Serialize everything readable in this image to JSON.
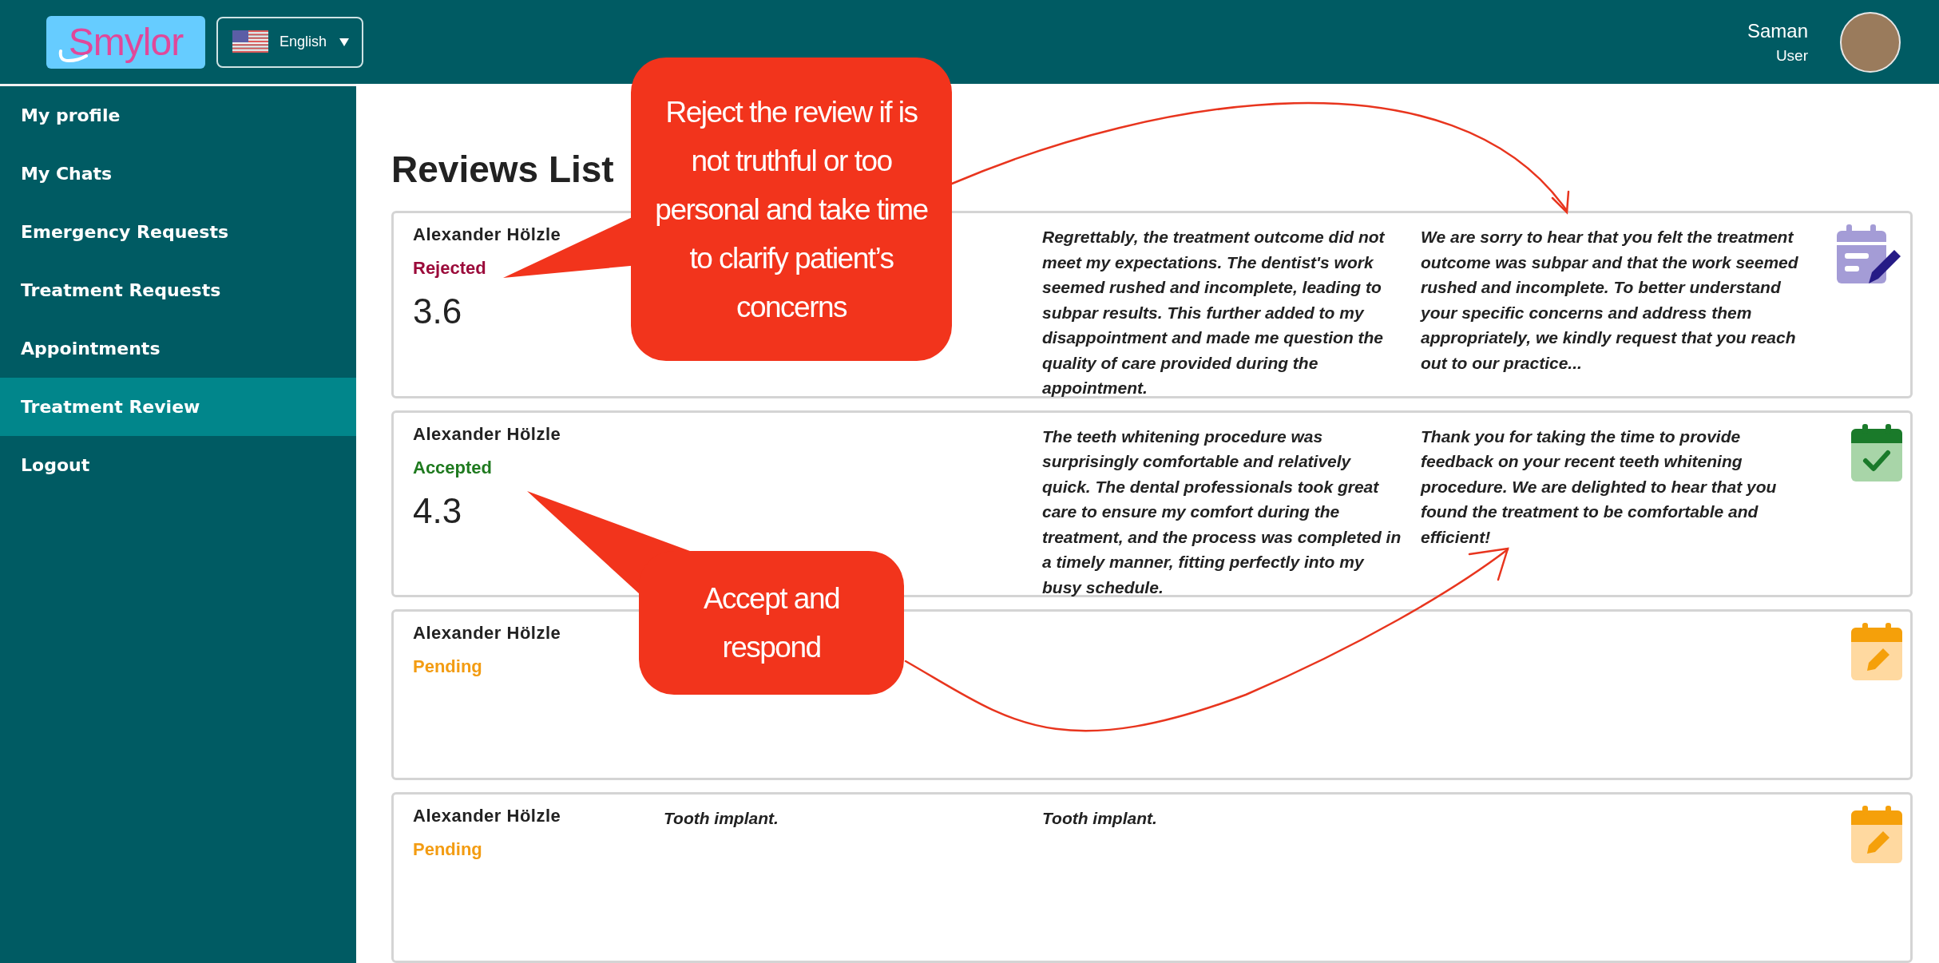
{
  "header": {
    "logo": "Smylor",
    "language": {
      "label": "English"
    },
    "user": {
      "name": "Saman",
      "role": "User"
    }
  },
  "sidebar": {
    "items": [
      {
        "label": "My profile",
        "selected": false
      },
      {
        "label": "My Chats",
        "selected": false
      },
      {
        "label": "Emergency Requests",
        "selected": false
      },
      {
        "label": "Treatment Requests",
        "selected": false
      },
      {
        "label": "Appointments",
        "selected": false
      },
      {
        "label": "Treatment Review",
        "selected": true
      },
      {
        "label": "Logout",
        "selected": false
      }
    ]
  },
  "page_title": "Reviews List",
  "reviews": [
    {
      "name": "Alexander Hölzle",
      "status": {
        "label": "Rejected",
        "kind": "rejected"
      },
      "rating": "3.6",
      "review": "Regrettably, the treatment outcome did not meet my expectations. The dentist's work seemed rushed and incomplete, leading to subpar results. This further added to my disappointment and made me question the quality of care provided during the appointment.",
      "response": "We are sorry to hear that you felt the treatment outcome was subpar and that the work seemed rushed and incomplete. To better understand your specific concerns and address them appropriately, we kindly request that you reach out to our practice..."
    },
    {
      "name": "Alexander Hölzle",
      "status": {
        "label": "Accepted",
        "kind": "accepted"
      },
      "rating": "4.3",
      "review": "The teeth whitening procedure was surprisingly comfortable and relatively quick. The dental professionals took great care to ensure my comfort during the treatment, and the process was completed in a timely manner, fitting perfectly into my busy schedule.",
      "response": "Thank you for taking the time to provide feedback on your recent teeth whitening procedure. We are delighted to hear that you found the treatment to be comfortable and efficient!"
    },
    {
      "name": "Alexander Hölzle",
      "status": {
        "label": "Pending",
        "kind": "pending"
      }
    },
    {
      "name": "Alexander Hölzle",
      "status": {
        "label": "Pending",
        "kind": "pending"
      },
      "column_2": "Tooth implant.",
      "review": "Tooth implant."
    }
  ],
  "annotations": [
    {
      "text": "Reject the review if is not truthful or too personal and take time to clarify patient’s concerns"
    },
    {
      "text": "Accept and respond"
    }
  ]
}
